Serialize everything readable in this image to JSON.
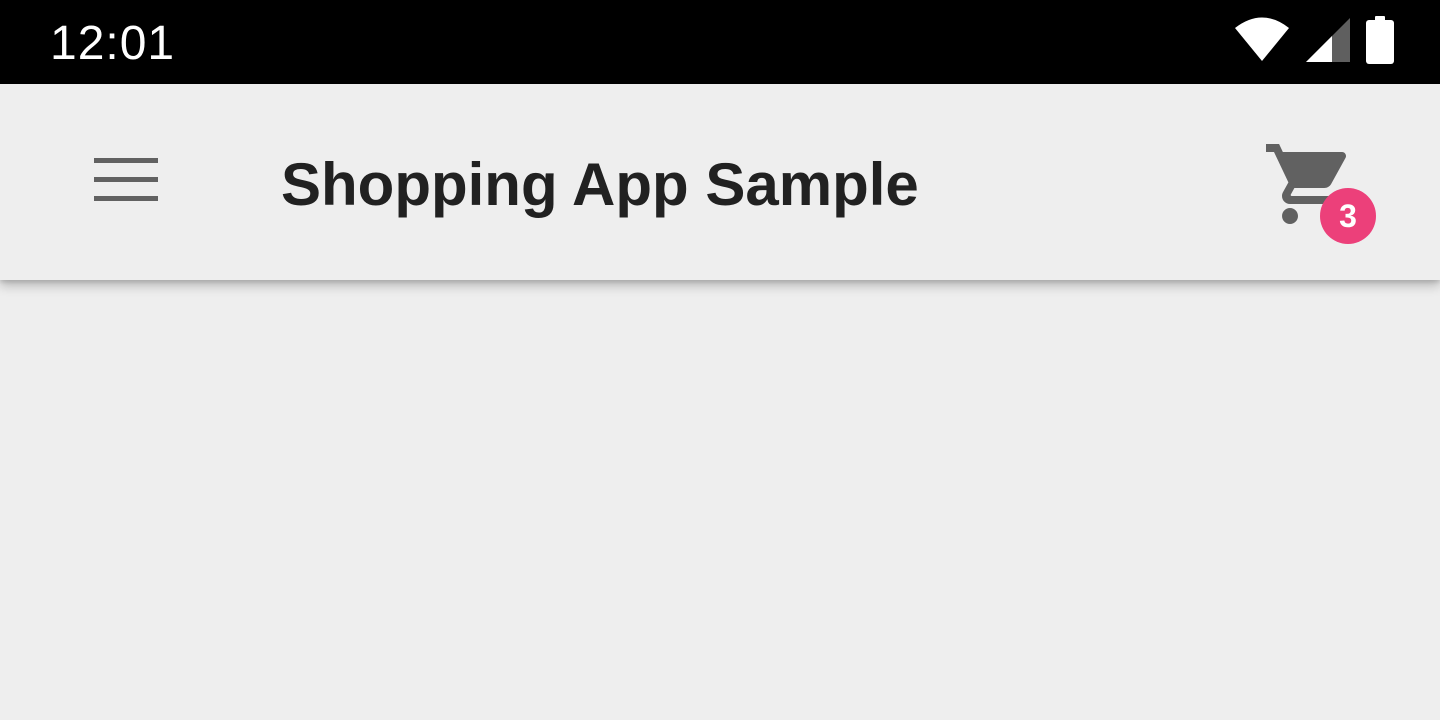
{
  "status_bar": {
    "time": "12:01",
    "icons": [
      "wifi-icon",
      "cellular-signal-icon",
      "battery-icon"
    ]
  },
  "app_bar": {
    "menu_icon": "hamburger-menu-icon",
    "title": "Shopping App Sample",
    "cart": {
      "icon": "shopping-cart-icon",
      "badge_count": "3"
    }
  },
  "colors": {
    "status_bar_background": "#000000",
    "app_bar_background": "#eeeeee",
    "icon_gray": "#616161",
    "title_text": "#212121",
    "badge_background": "#ec407a",
    "page_background": "#eeeeee"
  }
}
